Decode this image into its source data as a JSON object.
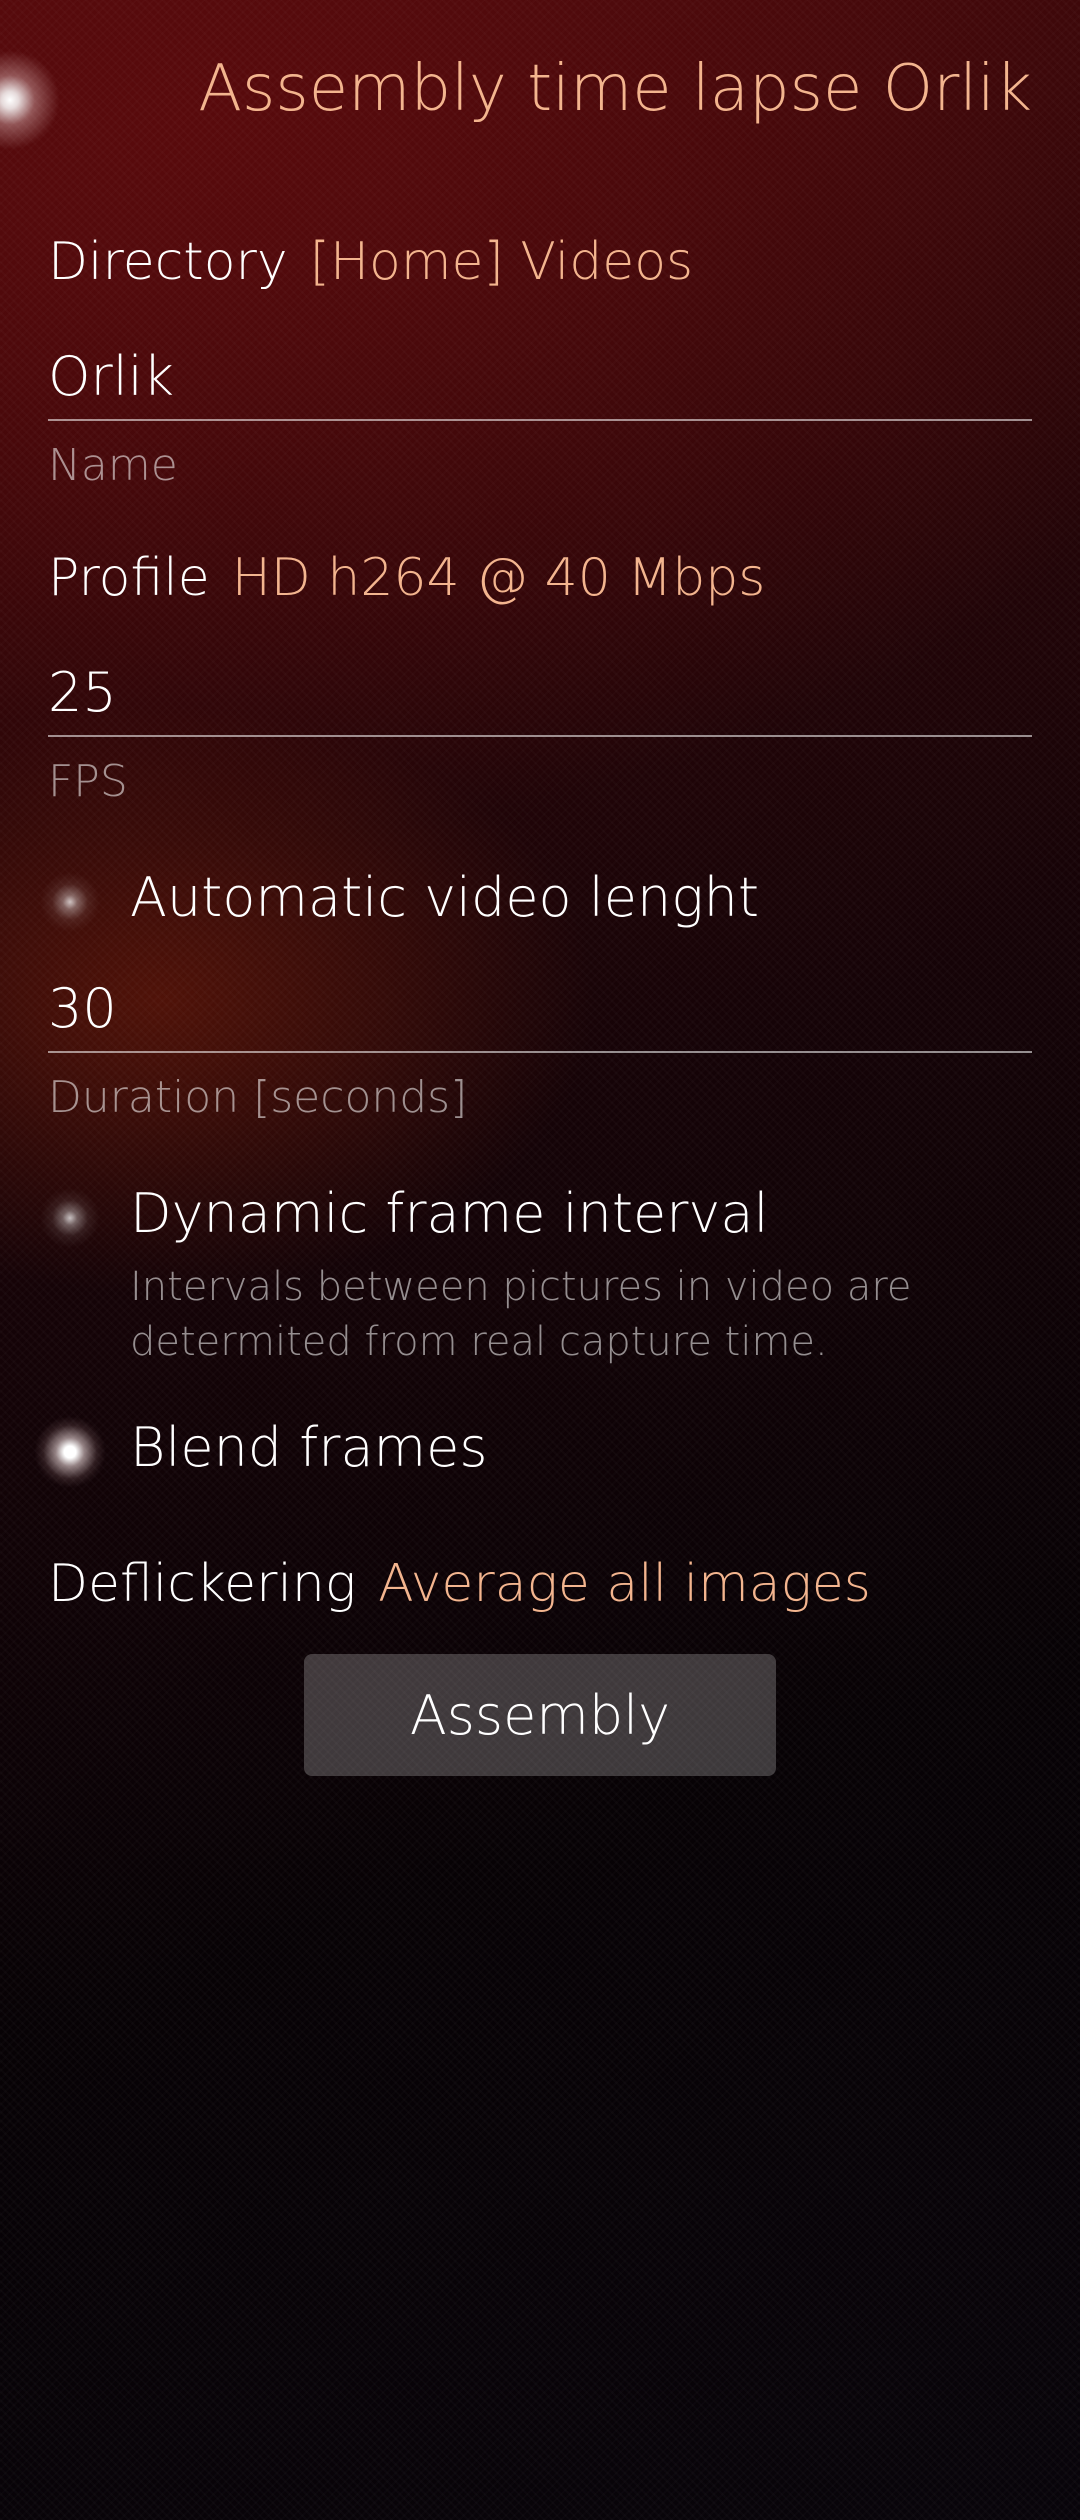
{
  "header": {
    "title": "Assembly time lapse Orlik"
  },
  "directory": {
    "label": "Directory",
    "value": "[Home] Videos"
  },
  "name_field": {
    "value": "Orlik",
    "label": "Name"
  },
  "profile": {
    "label": "Profile",
    "value": "HD h264 @ 40 Mbps"
  },
  "fps_field": {
    "value": "25",
    "label": "FPS"
  },
  "auto_length_switch": {
    "label": "Automatic video lenght",
    "checked": false
  },
  "duration_field": {
    "value": "30",
    "label": "Duration [seconds]"
  },
  "dynamic_interval_switch": {
    "label": "Dynamic frame interval",
    "description": "Intervals between pictures in video are determited from real capture time.",
    "checked": false
  },
  "blend_switch": {
    "label": "Blend frames",
    "checked": true
  },
  "deflickering": {
    "label": "Deflickering",
    "value": "Average all images"
  },
  "assembly_button": {
    "label": "Assembly"
  },
  "colors": {
    "highlight": "#f3b58f",
    "primary_text": "#ffffff",
    "secondary_text": "#8c8686"
  }
}
